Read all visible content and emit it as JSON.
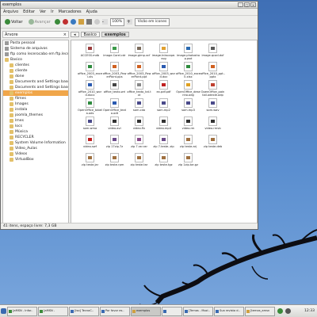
{
  "window": {
    "title": "exemplos",
    "menu": [
      "Arquivo",
      "Editar",
      "Ver",
      "Ir",
      "Marcadores",
      "Ajuda"
    ],
    "toolbar": {
      "back": "Voltar",
      "forward": "Avançar",
      "zoom": "100%",
      "view": "Visão em ícones"
    },
    "sidebar_label": "Árvore",
    "path": [
      "Basico",
      "exemplos"
    ],
    "status": "41 itens, espaço livre: 7,3 GB"
  },
  "tree": [
    {
      "label": "Pasta pessoal",
      "icon": "home-icon"
    },
    {
      "label": "Sistema de arquivos",
      "icon": "drive-icon"
    },
    {
      "label": "ftp como lecerocabo em ftp.lecerocabo.co",
      "icon": "network-icon"
    },
    {
      "label": "Basico",
      "icon": "folder-icon"
    },
    {
      "label": "clientes",
      "icon": "folder-icon"
    },
    {
      "label": "cliente",
      "icon": "folder-icon"
    },
    {
      "label": "done",
      "icon": "folder-icon"
    },
    {
      "label": "Documents and Settings base",
      "icon": "folder-icon"
    },
    {
      "label": "Documents and Settings base",
      "icon": "folder-icon"
    },
    {
      "label": "exemplos",
      "icon": "folder-icon",
      "selected": true
    },
    {
      "label": "filmes",
      "icon": "folder-icon"
    },
    {
      "label": "Images",
      "icon": "folder-icon"
    },
    {
      "label": "instala",
      "icon": "folder-icon"
    },
    {
      "label": "joomla_themes",
      "icon": "folder-icon"
    },
    {
      "label": "lmes",
      "icon": "folder-icon"
    },
    {
      "label": "locs",
      "icon": "folder-icon"
    },
    {
      "label": "Música",
      "icon": "folder-icon"
    },
    {
      "label": "RECYCLER",
      "icon": "folder-icon"
    },
    {
      "label": "System Volume Information",
      "icon": "folder-icon"
    },
    {
      "label": "Video_Aulas",
      "icon": "folder-icon"
    },
    {
      "label": "Videos",
      "icon": "folder-icon"
    },
    {
      "label": "VirtualBox",
      "icon": "folder-icon"
    }
  ],
  "files": [
    {
      "name": "ACCESS.mdb",
      "color": "#9b3b3b"
    },
    {
      "name": "image.Corel.cdr",
      "color": "#3c9a4a"
    },
    {
      "name": "image.gimp.xcf",
      "color": "#7a6a5a"
    },
    {
      "name": "image.Inkscape.svg",
      "color": "#e0a030"
    },
    {
      "name": "image.photoshop.psd",
      "color": "#2a6ab0"
    },
    {
      "name": "image.qcad.dxf",
      "color": "#5a5a5a"
    },
    {
      "name": "",
      "color": "#ffffff"
    },
    {
      "name": "office_2003_excel.xls",
      "color": "#2e8b3e"
    },
    {
      "name": "office_2003_PowerPoint.pps",
      "color": "#d06020"
    },
    {
      "name": "office_2003_PowerPoint.ppt",
      "color": "#d06020"
    },
    {
      "name": "office_2003_word.doc",
      "color": "#2a5ab0"
    },
    {
      "name": "office_2010_excell.xlsx",
      "color": "#2e8b3e"
    },
    {
      "name": "office_2010_ppt..pptx",
      "color": "#d06020"
    },
    {
      "name": "",
      "color": "#ffffff"
    },
    {
      "name": "office_2010_word.docx",
      "color": "#2a5ab0"
    },
    {
      "name": "office_texto.wri",
      "color": "#444444"
    },
    {
      "name": "office_texto_txt.txt",
      "color": "#888888"
    },
    {
      "name": "ex.pdf.pdf",
      "color": "#c02020"
    },
    {
      "name": "OpenOffice_desenho.odg",
      "color": "#e0a020"
    },
    {
      "name": "OpenOffice_paintail.odexle.odp",
      "color": "#c04030"
    },
    {
      "name": "",
      "color": "#ffffff"
    },
    {
      "name": "OpenOffice_tabela.ods",
      "color": "#2e8b3e"
    },
    {
      "name": "OpenOffice_texto.odt",
      "color": "#2a5ab0"
    },
    {
      "name": "som.cda",
      "color": "#4a4a8a"
    },
    {
      "name": "som.mp2",
      "color": "#4a4a8a"
    },
    {
      "name": "som.mp3",
      "color": "#4a4a8a"
    },
    {
      "name": "som.wav",
      "color": "#4a4a8a"
    },
    {
      "name": "",
      "color": "#ffffff"
    },
    {
      "name": "som.wma",
      "color": "#4a4a8a"
    },
    {
      "name": "video.avi",
      "color": "#333333"
    },
    {
      "name": "video.flv",
      "color": "#333333"
    },
    {
      "name": "video.mp4",
      "color": "#333333"
    },
    {
      "name": "video.rm",
      "color": "#333333"
    },
    {
      "name": "video.rmvb",
      "color": "#333333"
    },
    {
      "name": "",
      "color": "#ffffff"
    },
    {
      "name": "video.swf",
      "color": "#c02020"
    },
    {
      "name": "zip 17zip.7z",
      "color": "#6a4a8a"
    },
    {
      "name": "zip 7.rar.rar",
      "color": "#8a4a8a"
    },
    {
      "name": "zip 7.teste..zip",
      "color": "#6a4a8a"
    },
    {
      "name": "zip teste.arj",
      "color": "#a07040"
    },
    {
      "name": "zip teste.deb",
      "color": "#a07040"
    },
    {
      "name": "",
      "color": "#ffffff"
    },
    {
      "name": "zip teste.jar",
      "color": "#a07040"
    },
    {
      "name": "zip teste.rpm",
      "color": "#a07040"
    },
    {
      "name": "zip teste.tar",
      "color": "#a07040"
    },
    {
      "name": "zip teste.tgz",
      "color": "#a07040"
    },
    {
      "name": "zip 1zip.tar.gz",
      "color": "#a07040"
    }
  ],
  "taskbar": {
    "items": [
      {
        "label": "[aMSN - Infor..",
        "icon": "msn-icon"
      },
      {
        "label": "[aMSN -",
        "icon": "msn-icon"
      },
      {
        "label": "[Iso] TecnoC..",
        "icon": "browser-icon"
      },
      {
        "label": "Por favor es..",
        "icon": "browser-icon"
      },
      {
        "label": "exemplos",
        "icon": "folder-icon",
        "active": true
      },
      {
        "label": "",
        "icon": "app-icon"
      },
      {
        "label": "[Temas - Mozi..",
        "icon": "browser-icon"
      },
      {
        "label": "Sua revista d..",
        "icon": "browser-icon"
      },
      {
        "label": "[temas_amsn",
        "icon": "folder-icon"
      }
    ],
    "clock": "12:33"
  }
}
